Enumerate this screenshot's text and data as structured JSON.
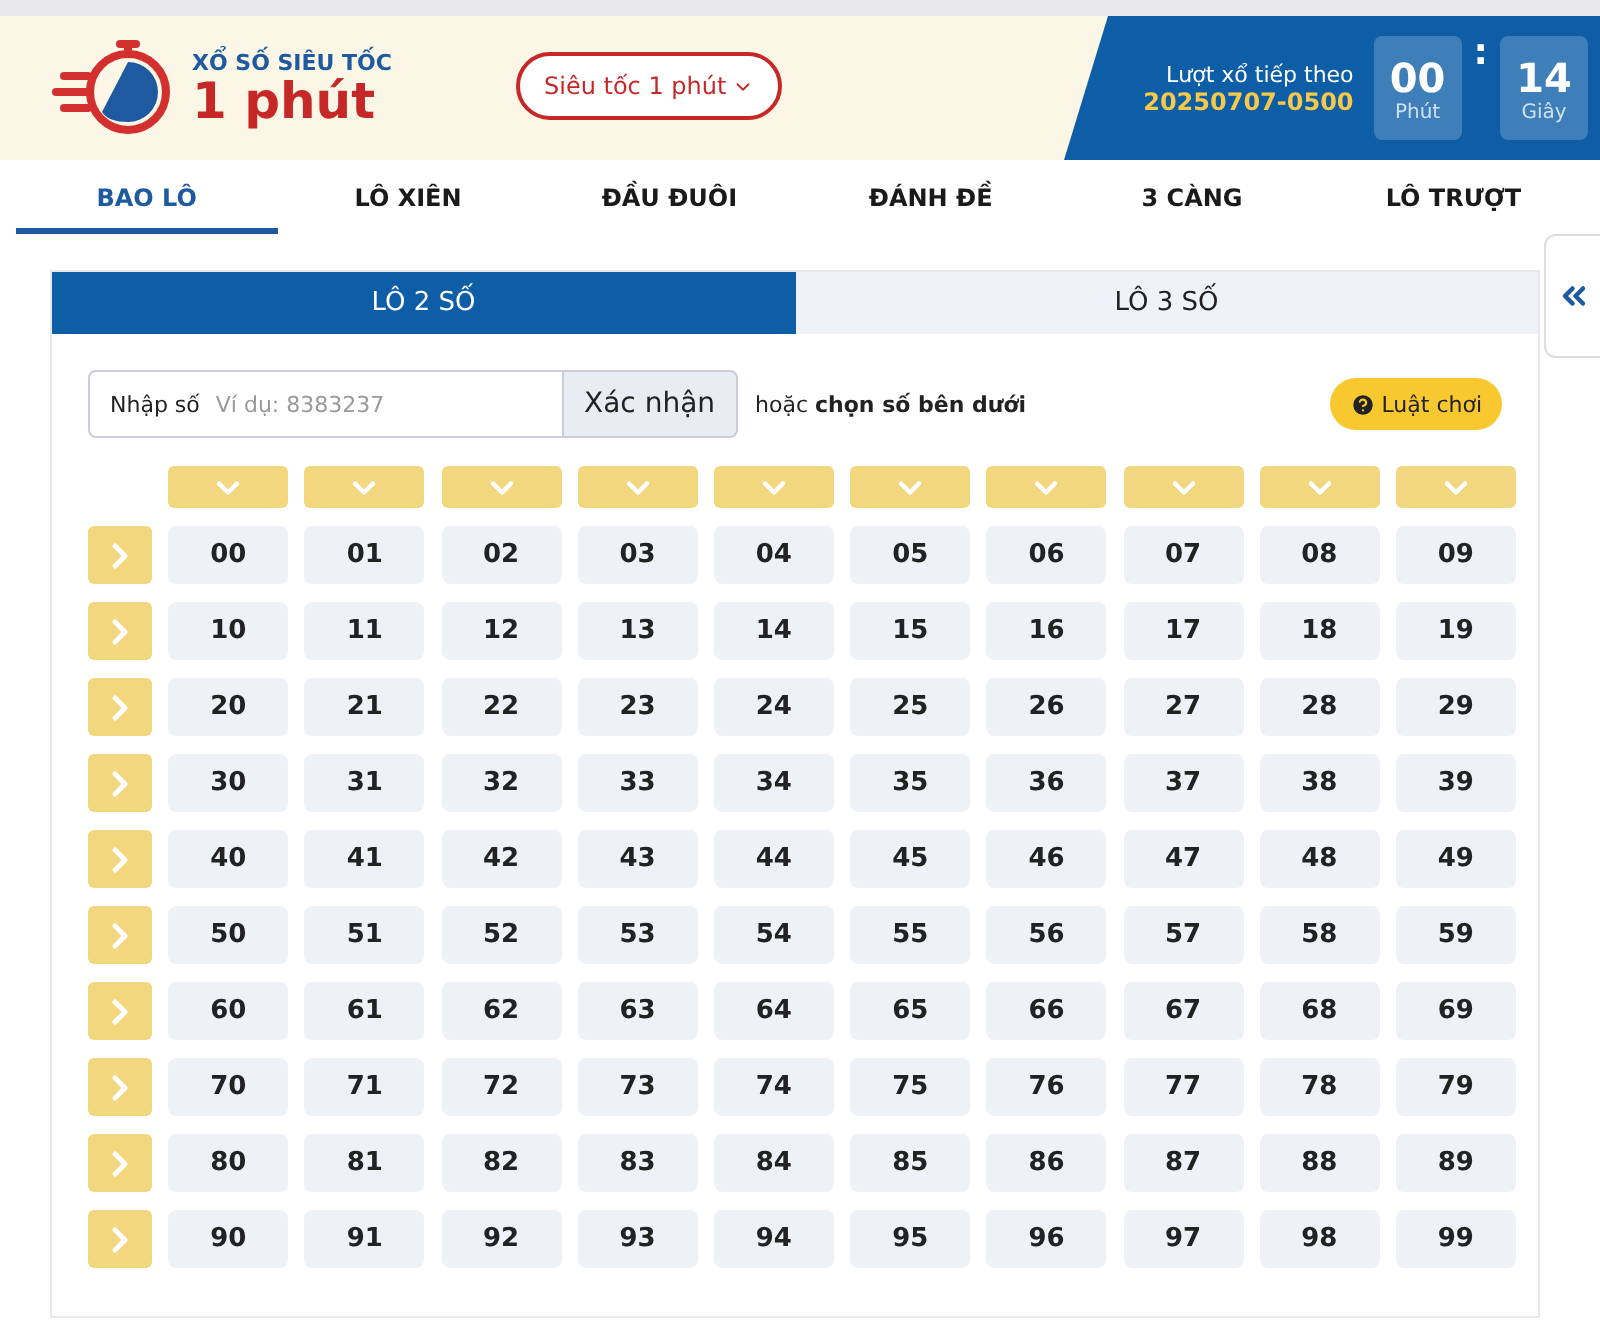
{
  "header": {
    "logo_caption": "XỔ SỐ SIÊU TỐC",
    "logo_title": "1 phút",
    "game_select": "Siêu tốc 1 phút",
    "next_draw_label": "Lượt xổ tiếp theo",
    "next_draw_id": "20250707-0500",
    "countdown": [
      {
        "value": "00",
        "unit": "Phút"
      },
      {
        "value": "14",
        "unit": "Giây"
      }
    ],
    "separator": ":"
  },
  "tabs": [
    {
      "label": "BAO LÔ",
      "selected": true
    },
    {
      "label": "LÔ XIÊN",
      "selected": false
    },
    {
      "label": "ĐẦU ĐUÔI",
      "selected": false
    },
    {
      "label": "ĐÁNH ĐỀ",
      "selected": false
    },
    {
      "label": "3 CÀNG",
      "selected": false
    },
    {
      "label": "LÔ TRƯỢT",
      "selected": false
    }
  ],
  "subtabs": [
    {
      "label": "LÔ 2 SỐ",
      "selected": true
    },
    {
      "label": "LÔ 3 SỐ",
      "selected": false
    }
  ],
  "entry": {
    "label": "Nhập số",
    "placeholder": "Ví dụ: 8383237",
    "submit": "Xác nhận",
    "hint": "hoặc **chọn số bên dưới**",
    "rules_button": "Luật chơi"
  },
  "number_grid": [
    [
      "00",
      "01",
      "02",
      "03",
      "04",
      "05",
      "06",
      "07",
      "08",
      "09"
    ],
    [
      "10",
      "11",
      "12",
      "13",
      "14",
      "15",
      "16",
      "17",
      "18",
      "19"
    ],
    [
      "20",
      "21",
      "22",
      "23",
      "24",
      "25",
      "26",
      "27",
      "28",
      "29"
    ],
    [
      "30",
      "31",
      "32",
      "33",
      "34",
      "35",
      "36",
      "37",
      "38",
      "39"
    ],
    [
      "40",
      "41",
      "42",
      "43",
      "44",
      "45",
      "46",
      "47",
      "48",
      "49"
    ],
    [
      "50",
      "51",
      "52",
      "53",
      "54",
      "55",
      "56",
      "57",
      "58",
      "59"
    ],
    [
      "60",
      "61",
      "62",
      "63",
      "64",
      "65",
      "66",
      "67",
      "68",
      "69"
    ],
    [
      "70",
      "71",
      "72",
      "73",
      "74",
      "75",
      "76",
      "77",
      "78",
      "79"
    ],
    [
      "80",
      "81",
      "82",
      "83",
      "84",
      "85",
      "86",
      "87",
      "88",
      "89"
    ],
    [
      "90",
      "91",
      "92",
      "93",
      "94",
      "95",
      "96",
      "97",
      "98",
      "99"
    ]
  ]
}
